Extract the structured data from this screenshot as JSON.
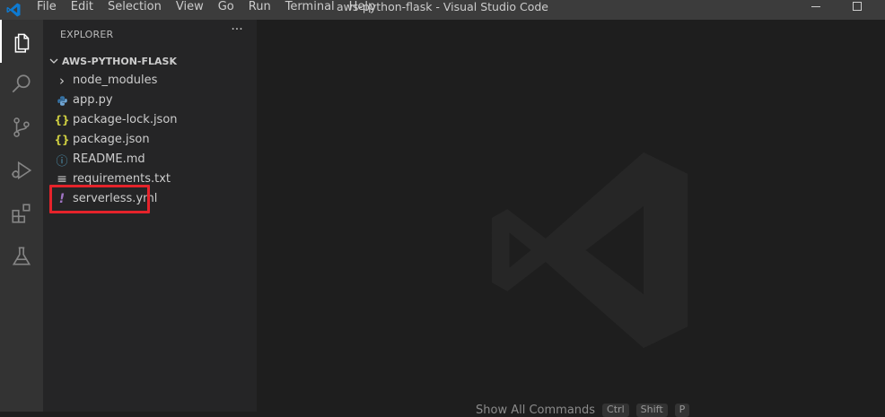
{
  "titlebar": {
    "menus": [
      "File",
      "Edit",
      "Selection",
      "View",
      "Go",
      "Run",
      "Terminal",
      "Help"
    ],
    "title": "aws-python-flask - Visual Studio Code"
  },
  "activity_bar": {
    "items": [
      "explorer-icon",
      "search-icon",
      "source-control-icon",
      "run-debug-icon",
      "extensions-icon",
      "testing-icon"
    ],
    "active": "explorer-icon"
  },
  "sidebar": {
    "header": "EXPLORER",
    "more": "···",
    "folder": "AWS-PYTHON-FLASK",
    "items": [
      {
        "label": "node_modules",
        "icon": "chevron-right-icon",
        "glyph": "›"
      },
      {
        "label": "app.py",
        "icon": "python-file-icon",
        "glyph": ""
      },
      {
        "label": "package-lock.json",
        "icon": "json-file-icon",
        "glyph": "{}"
      },
      {
        "label": "package.json",
        "icon": "json-file-icon",
        "glyph": "{}"
      },
      {
        "label": "README.md",
        "icon": "info-file-icon",
        "glyph": "ⓘ"
      },
      {
        "label": "requirements.txt",
        "icon": "text-file-icon",
        "glyph": "≡"
      },
      {
        "label": "serverless.yml",
        "icon": "yaml-file-icon",
        "glyph": "!"
      }
    ],
    "highlighted": "serverless.yml",
    "colors": {
      "json": "#cbcb41",
      "yaml": "#a074c4",
      "info": "#519aba",
      "python": "#3572a5",
      "highlight": "#e5232b"
    }
  },
  "editor": {
    "hint_label": "Show All Commands",
    "hint_keys": [
      "Ctrl",
      "Shift",
      "P"
    ]
  }
}
